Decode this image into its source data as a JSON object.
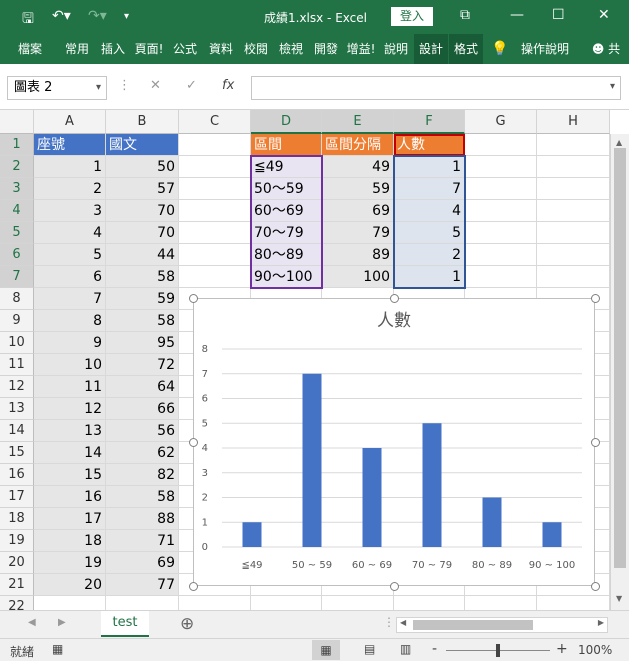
{
  "window": {
    "title": "成績1.xlsx - Excel",
    "signin": "登入",
    "controls": [
      "⧉",
      "—",
      "☐",
      "✕"
    ]
  },
  "ribbon": {
    "tabs": [
      "檔案",
      "常用",
      "插入",
      "頁面!",
      "公式",
      "資料",
      "校閱",
      "檢視",
      "開發",
      "增益!",
      "說明",
      "設計",
      "格式"
    ],
    "tell_me": "操作說明",
    "share": "共"
  },
  "formula_bar": {
    "name_box": "圖表 2",
    "fx": "fx",
    "value": ""
  },
  "sheet": {
    "columns": [
      "A",
      "B",
      "C",
      "D",
      "E",
      "F",
      "G",
      "H"
    ],
    "rows": [
      "1",
      "2",
      "3",
      "4",
      "5",
      "6",
      "7",
      "8",
      "9",
      "10",
      "11",
      "12",
      "13",
      "14",
      "15",
      "16",
      "17",
      "18",
      "19",
      "20",
      "21",
      "22"
    ],
    "colA_header": "座號",
    "colB_header": "國文",
    "students": [
      [
        1,
        50
      ],
      [
        2,
        57
      ],
      [
        3,
        70
      ],
      [
        4,
        70
      ],
      [
        5,
        44
      ],
      [
        6,
        58
      ],
      [
        7,
        59
      ],
      [
        8,
        58
      ],
      [
        9,
        95
      ],
      [
        10,
        72
      ],
      [
        11,
        64
      ],
      [
        12,
        66
      ],
      [
        13,
        56
      ],
      [
        14,
        62
      ],
      [
        15,
        82
      ],
      [
        16,
        58
      ],
      [
        17,
        88
      ],
      [
        18,
        71
      ],
      [
        19,
        69
      ],
      [
        20,
        77
      ]
    ],
    "colD_header": "區間",
    "colE_header": "區間分隔",
    "colF_header": "人數",
    "bins": [
      [
        "≦49",
        49,
        1
      ],
      [
        "50～59",
        59,
        7
      ],
      [
        "60～69",
        69,
        4
      ],
      [
        "70～79",
        79,
        5
      ],
      [
        "80～89",
        89,
        2
      ],
      [
        "90～100",
        100,
        1
      ]
    ]
  },
  "chart_data": {
    "type": "bar",
    "title": "人數",
    "categories": [
      "≦49",
      "50 ~ 59",
      "60 ~ 69",
      "70 ~ 79",
      "80 ~ 89",
      "90 ~ 100"
    ],
    "values": [
      1,
      7,
      4,
      5,
      2,
      1
    ],
    "ylim": [
      0,
      8
    ],
    "yticks": [
      "0",
      "1",
      "2",
      "3",
      "4",
      "5",
      "6",
      "7",
      "8"
    ],
    "color": "#4472c4",
    "grid": true,
    "legend": "none"
  },
  "tabs": {
    "sheet_name": "test",
    "add": "⊕"
  },
  "status": {
    "ready": "就緒",
    "zoom": "100%",
    "minus": "-",
    "plus": "+"
  }
}
